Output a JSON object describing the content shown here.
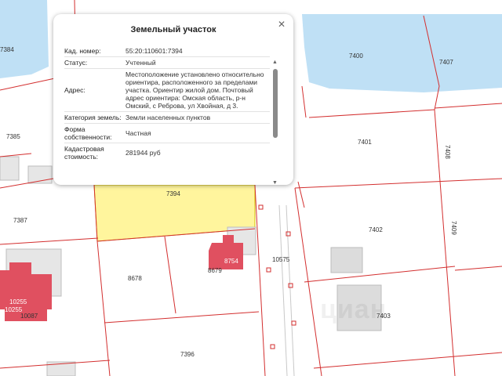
{
  "popup": {
    "title": "Земельный участок",
    "rows": [
      {
        "label": "Кад. номер:",
        "value": "55:20:110601:7394"
      },
      {
        "label": "Статус:",
        "value": "Учтенный"
      },
      {
        "label": "Адрес:",
        "value": "Местоположение установлено относительно ориентира, расположенного за пределами участка. Ориентир жилой дом. Почтовый адрес ориентира: Омская область, р-н Омский, с Реброва, ул Хвойная, д 3."
      },
      {
        "label": "Категория земель:",
        "value": "Земли населенных пунктов"
      },
      {
        "label": "Форма собственности:",
        "value": "Частная"
      },
      {
        "label": "Кадастровая стоимость:",
        "value": "281944 руб"
      }
    ],
    "close_icon": "close-icon"
  },
  "map": {
    "parcels": {
      "p7384": "7384",
      "p7385": "7385",
      "p7387": "7387",
      "p7400": "7400",
      "p7407": "7407",
      "p7401": "7401",
      "p7408": "7408",
      "p7394": "7394",
      "p7402": "7402",
      "p7409": "7409",
      "p8678": "8678",
      "p8679": "8679",
      "p8754": "8754",
      "p10575": "10575",
      "p10255a": "10255",
      "p10255b": "10255",
      "p10087": "10087",
      "p7403": "7403",
      "p7396": "7396"
    },
    "watermark": "циан",
    "colors": {
      "boundary": "#d32f2f",
      "water": "#bfe0f5",
      "selected": "#fff59d",
      "building": "#e05060"
    }
  }
}
